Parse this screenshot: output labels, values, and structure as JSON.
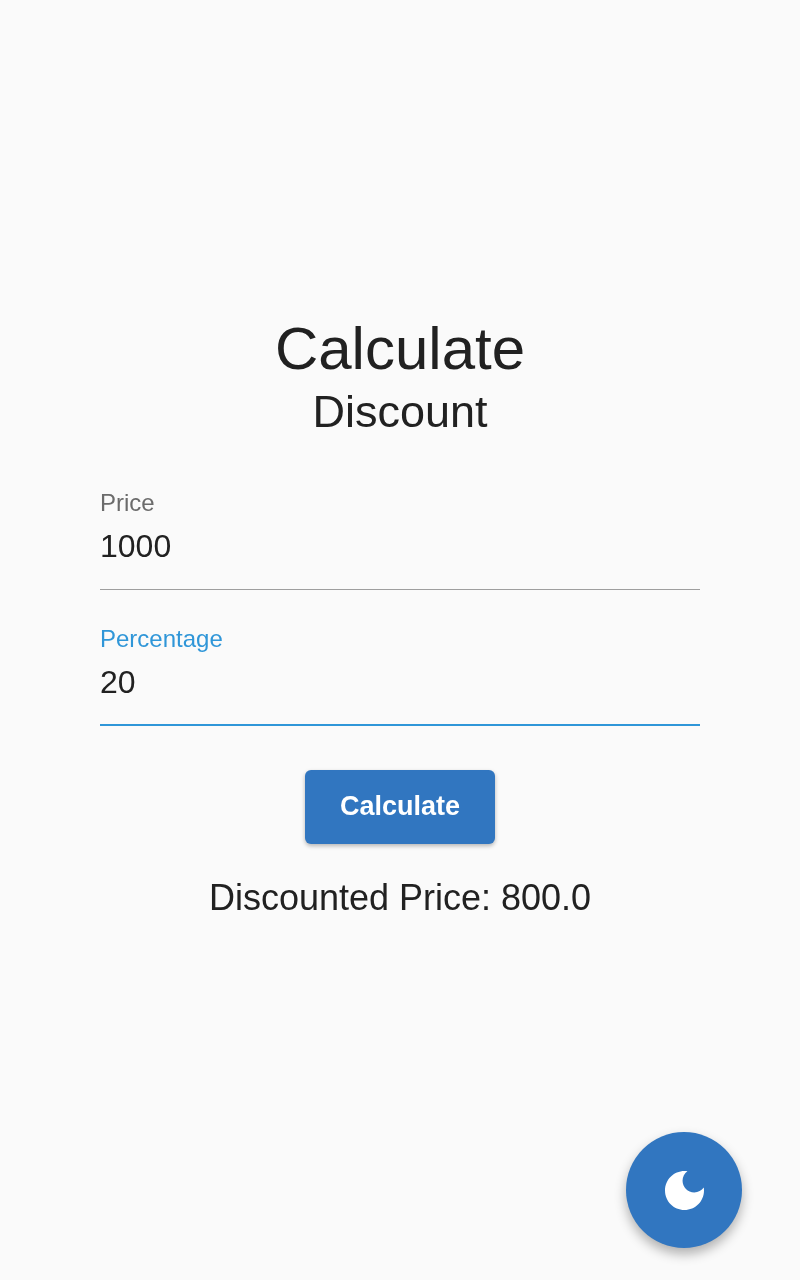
{
  "title": "Calculate",
  "subtitle": "Discount",
  "fields": [
    {
      "label": "Price",
      "value": "1000",
      "focused": false
    },
    {
      "label": "Percentage",
      "value": "20",
      "focused": true
    }
  ],
  "calculate_button": {
    "label": "Calculate"
  },
  "result": "Discounted Price: 800.0"
}
